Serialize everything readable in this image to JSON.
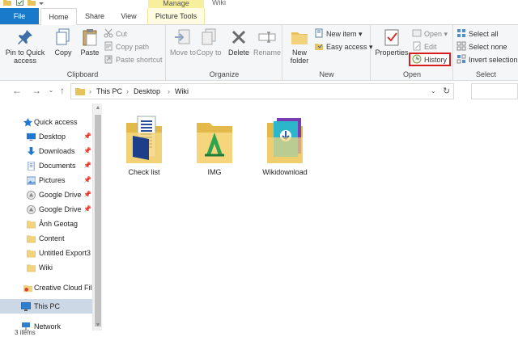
{
  "window": {
    "title": "Wiki",
    "contextual_tab_group": "Manage"
  },
  "tabs": {
    "file": "File",
    "home": "Home",
    "share": "Share",
    "view": "View",
    "picture_tools": "Picture Tools"
  },
  "ribbon": {
    "clipboard": {
      "label": "Clipboard",
      "pin": "Pin to Quick access",
      "copy": "Copy",
      "paste": "Paste",
      "cut": "Cut",
      "copy_path": "Copy path",
      "paste_shortcut": "Paste shortcut"
    },
    "organize": {
      "label": "Organize",
      "move_to": "Move to",
      "copy_to": "Copy to",
      "delete": "Delete",
      "rename": "Rename"
    },
    "new": {
      "label": "New",
      "new_folder": "New folder",
      "new_item": "New item",
      "easy_access": "Easy access"
    },
    "open": {
      "label": "Open",
      "properties": "Properties",
      "open": "Open",
      "edit": "Edit",
      "history": "History"
    },
    "select": {
      "label": "Select",
      "select_all": "Select all",
      "select_none": "Select none",
      "invert_selection": "Invert selection"
    }
  },
  "address": {
    "crumbs": [
      "This PC",
      "Desktop",
      "Wiki"
    ]
  },
  "nav": {
    "quick_access": "Quick access",
    "items": [
      {
        "label": "Desktop",
        "icon": "desktop-icon",
        "pinned": true
      },
      {
        "label": "Downloads",
        "icon": "download-icon",
        "pinned": true
      },
      {
        "label": "Documents",
        "icon": "documents-icon",
        "pinned": true
      },
      {
        "label": "Pictures",
        "icon": "pictures-icon",
        "pinned": true
      },
      {
        "label": "Google Drive",
        "icon": "google-drive-icon",
        "pinned": true
      },
      {
        "label": "Google Drive",
        "icon": "google-drive-icon",
        "pinned": true
      },
      {
        "label": "Ảnh Geotag",
        "icon": "folder-icon",
        "pinned": false
      },
      {
        "label": "Content",
        "icon": "folder-icon",
        "pinned": false
      },
      {
        "label": "Untitled Export3",
        "icon": "folder-icon",
        "pinned": false
      },
      {
        "label": "Wiki",
        "icon": "folder-icon",
        "pinned": false
      }
    ],
    "creative_cloud": "Creative Cloud Fil",
    "this_pc": "This PC",
    "network": "Network",
    "pin_glyph": "★"
  },
  "files": [
    {
      "name": "Check list",
      "icon": "folder-document-icon"
    },
    {
      "name": "IMG",
      "icon": "folder-image-icon"
    },
    {
      "name": "Wikidownload",
      "icon": "folder-image-icon"
    }
  ],
  "status": {
    "text": "3 items"
  },
  "colors": {
    "file_tab": "#1979ca",
    "manage_tab": "#f7ef9c",
    "history_highlight": "#d81d1d",
    "selected_row": "#ccd8e6"
  }
}
